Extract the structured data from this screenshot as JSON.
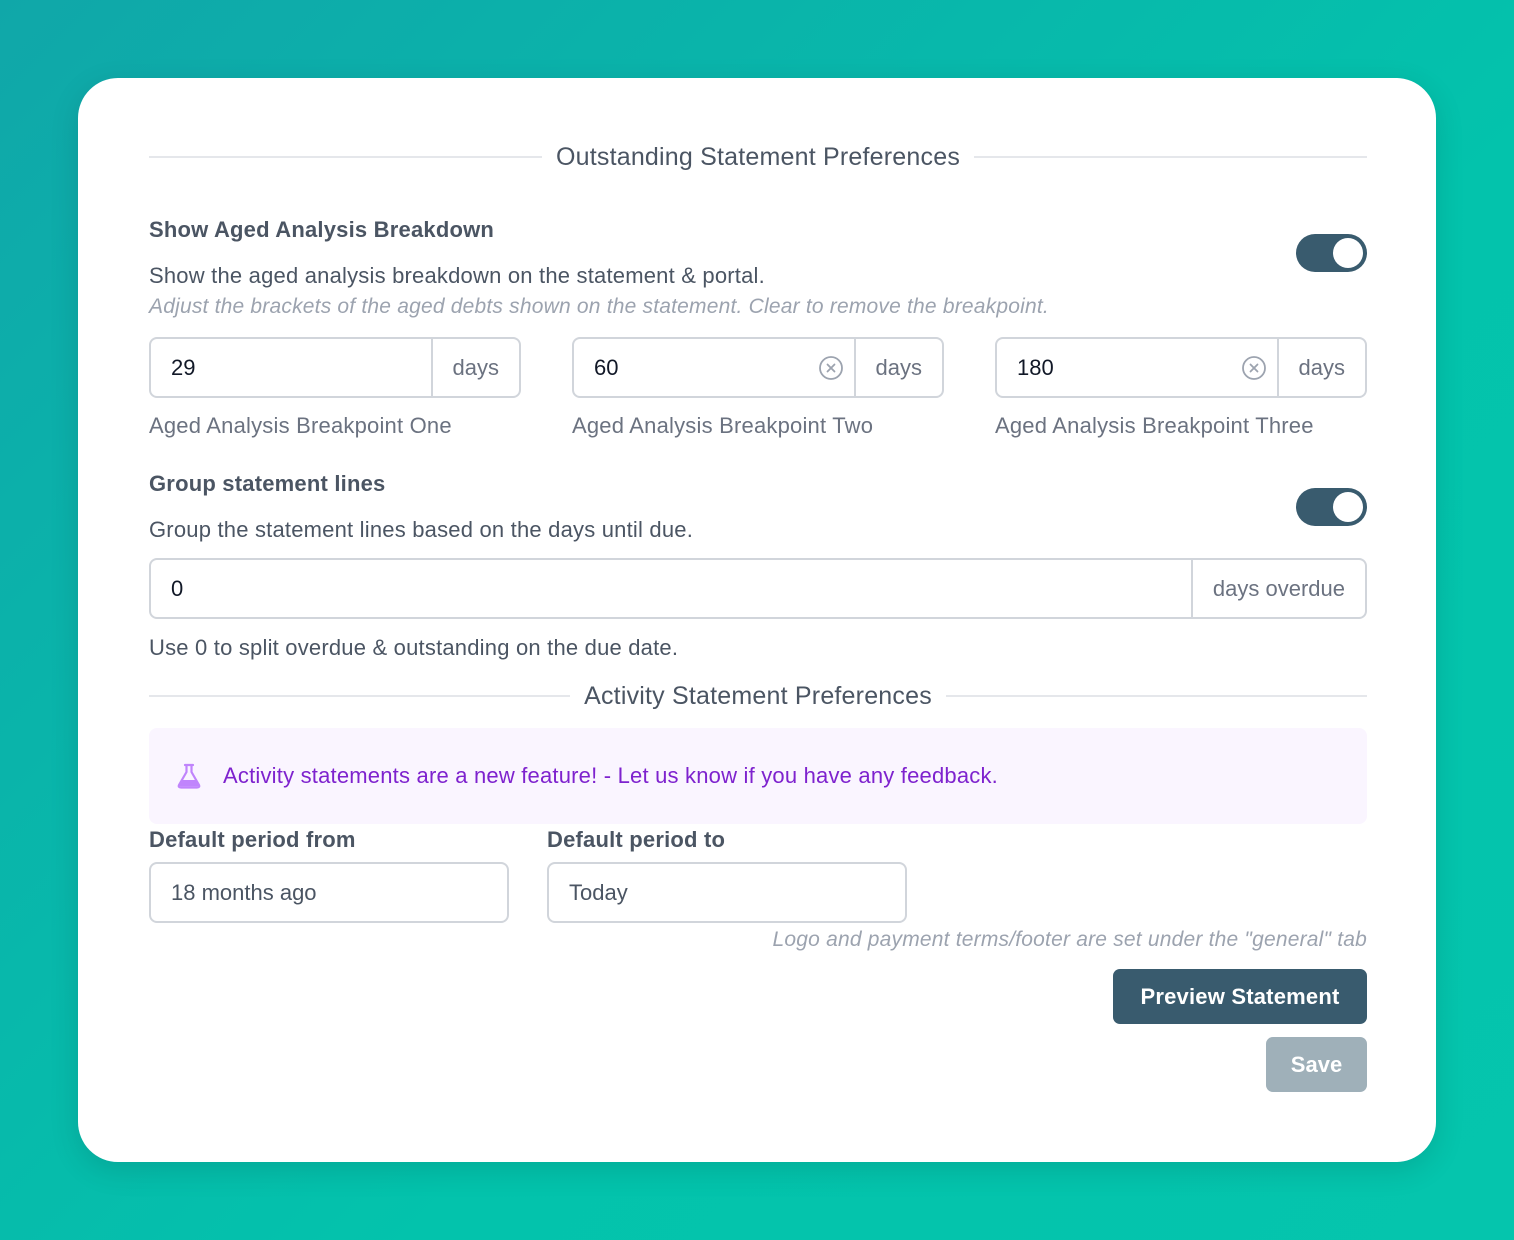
{
  "outstanding": {
    "section_title": "Outstanding Statement Preferences",
    "aged_analysis": {
      "title": "Show Aged Analysis Breakdown",
      "description": "Show the aged analysis breakdown on the statement & portal.",
      "hint": "Adjust the brackets of the aged debts shown on the statement. Clear to remove the breakpoint.",
      "enabled": true,
      "breakpoints": [
        {
          "value": "29",
          "suffix": "days",
          "caption": "Aged Analysis Breakpoint One"
        },
        {
          "value": "60",
          "suffix": "days",
          "caption": "Aged Analysis Breakpoint Two"
        },
        {
          "value": "180",
          "suffix": "days",
          "caption": "Aged Analysis Breakpoint Three"
        }
      ]
    },
    "group_lines": {
      "title": "Group statement lines",
      "description": "Group the statement lines based on the days until due.",
      "enabled": true,
      "value": "0",
      "suffix": "days overdue",
      "help": "Use 0 to split overdue & outstanding on the due date."
    }
  },
  "activity": {
    "section_title": "Activity Statement Preferences",
    "notice": {
      "icon": "flask-icon",
      "text": "Activity statements are a new feature! - Let us know if you have any feedback."
    },
    "period_from": {
      "label": "Default period from",
      "value": "18 months ago"
    },
    "period_to": {
      "label": "Default period to",
      "value": "Today"
    }
  },
  "footer": {
    "note": "Logo and payment terms/footer are set under the \"general\" tab",
    "preview_label": "Preview Statement",
    "save_label": "Save"
  },
  "colors": {
    "accent": "#395b6e",
    "notice_text": "#7e22ce",
    "notice_bg": "#faf5ff",
    "disabled_button": "#9fb0b9"
  }
}
